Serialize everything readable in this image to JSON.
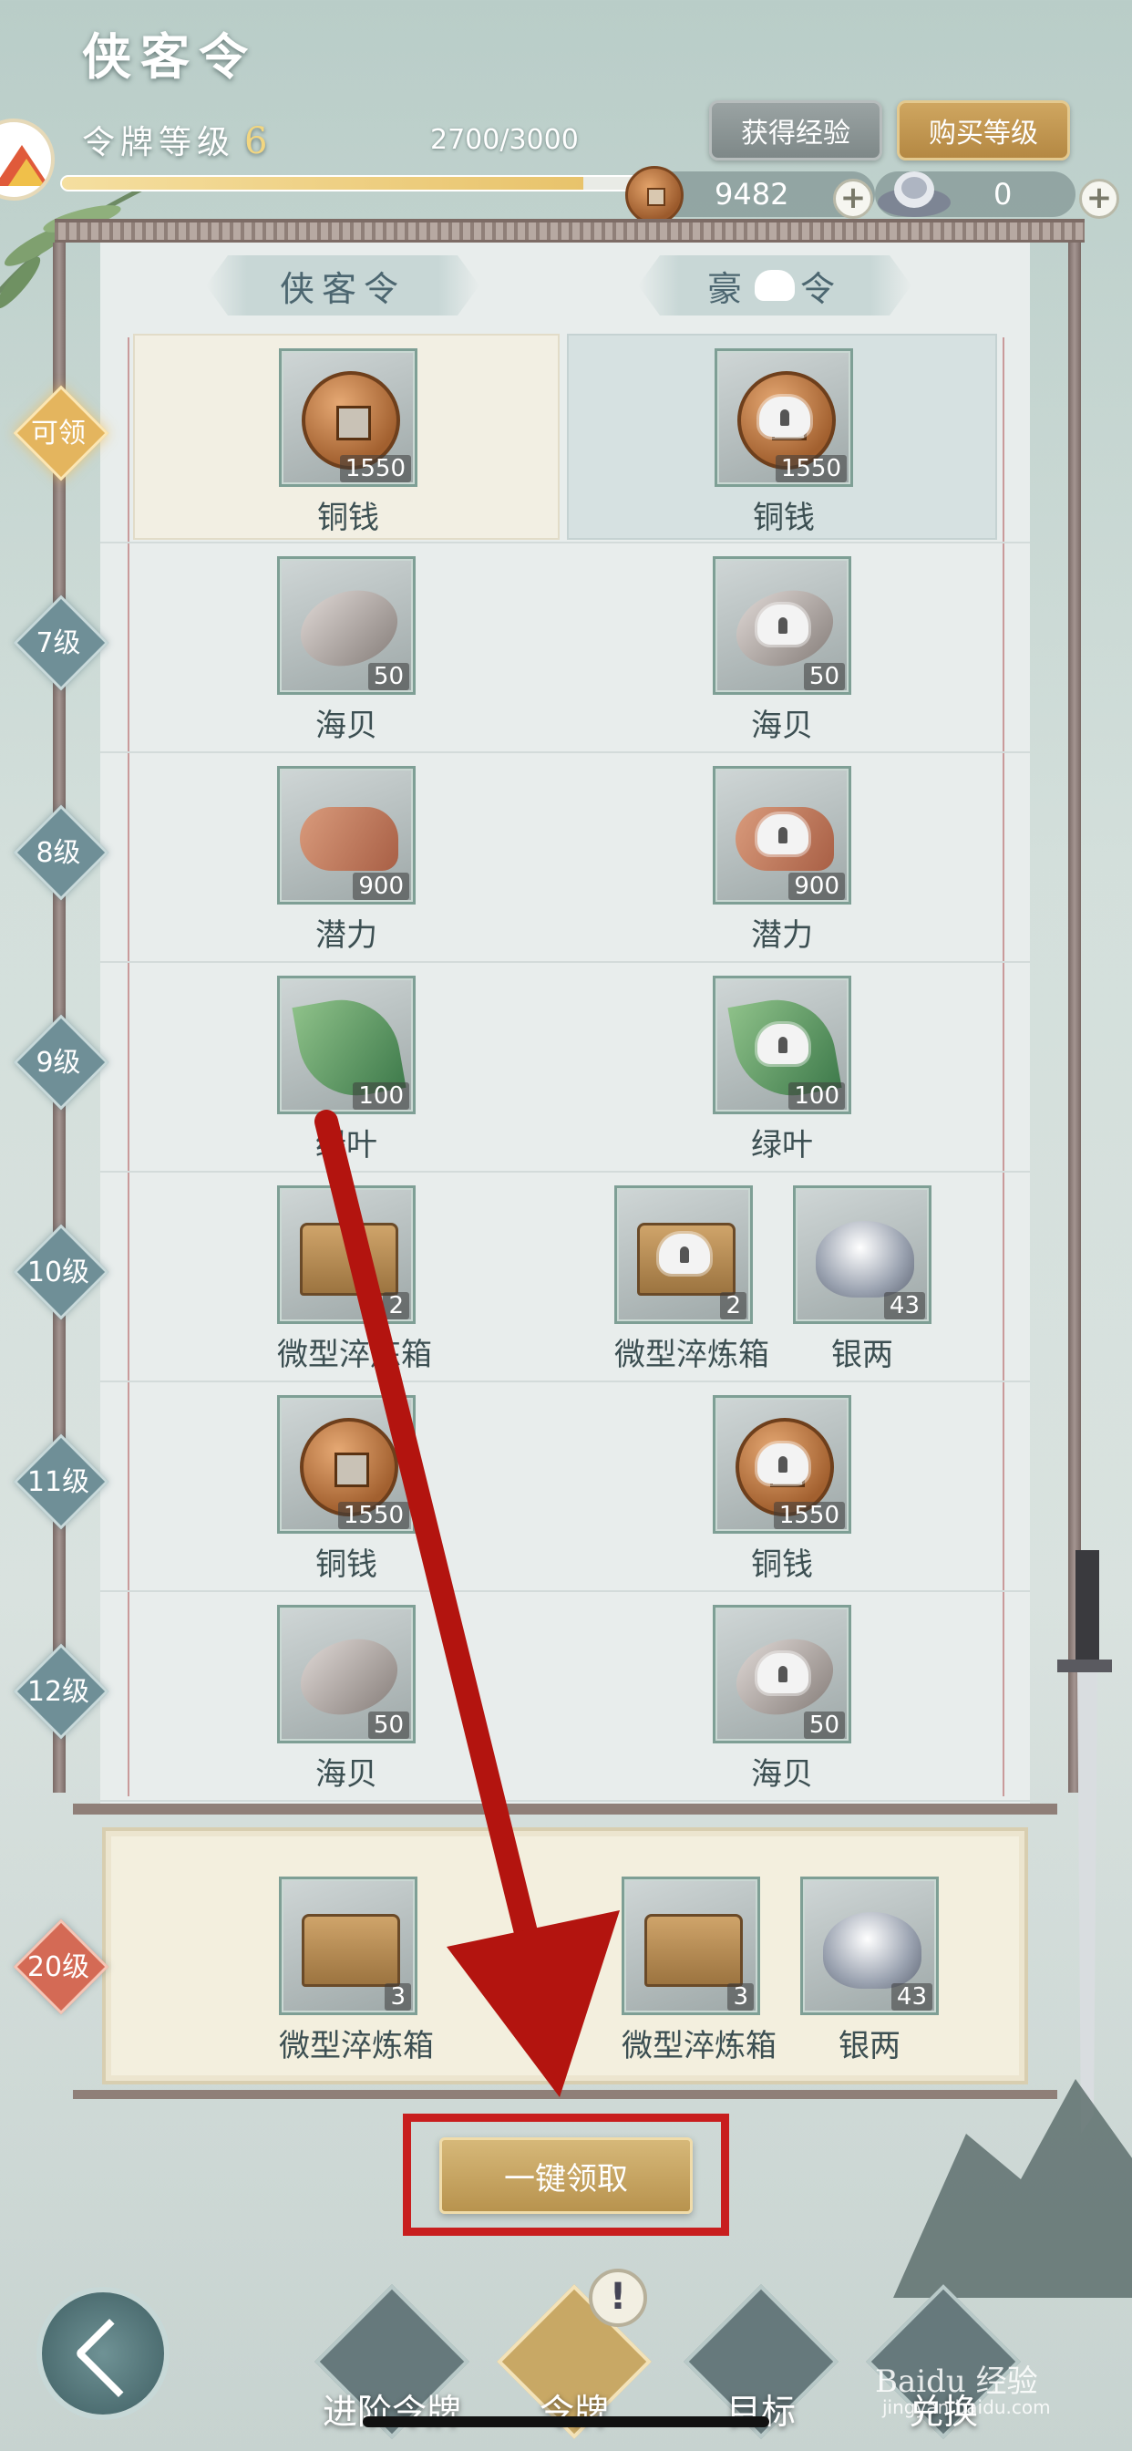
{
  "header": {
    "title": "侠客令",
    "level_label": "令牌等级",
    "level": "6",
    "exp_text": "2700/3000",
    "exp_progress": 0.9,
    "btn_get_exp": "获得经验",
    "btn_buy_level": "购买等级",
    "coin_amount": "9482",
    "silver_amount": "0",
    "plus": "+"
  },
  "columns": {
    "free": "侠客令",
    "hero_left": "豪",
    "hero_right": "令"
  },
  "rows": [
    {
      "badge": "可领",
      "badge_style": "gold",
      "free": [
        {
          "name": "铜钱",
          "count": "1550",
          "art": "coin"
        }
      ],
      "hero": [
        {
          "name": "铜钱",
          "count": "1550",
          "art": "coin"
        }
      ]
    },
    {
      "badge": "7级",
      "free": [
        {
          "name": "海贝",
          "count": "50",
          "art": "shell"
        }
      ],
      "hero": [
        {
          "name": "海贝",
          "count": "50",
          "art": "shell"
        }
      ]
    },
    {
      "badge": "8级",
      "free": [
        {
          "name": "潜力",
          "count": "900",
          "art": "arm"
        }
      ],
      "hero": [
        {
          "name": "潜力",
          "count": "900",
          "art": "arm"
        }
      ]
    },
    {
      "badge": "9级",
      "free": [
        {
          "name": "绿叶",
          "count": "100",
          "art": "leaf"
        }
      ],
      "hero": [
        {
          "name": "绿叶",
          "count": "100",
          "art": "leaf"
        }
      ]
    },
    {
      "badge": "10级",
      "free": [
        {
          "name": "微型淬炼箱",
          "count": "2",
          "art": "chest"
        }
      ],
      "hero": [
        {
          "name": "微型淬炼箱",
          "count": "2",
          "art": "chest"
        },
        {
          "name": "银两",
          "count": "43",
          "art": "silver"
        }
      ]
    },
    {
      "badge": "11级",
      "free": [
        {
          "name": "铜钱",
          "count": "1550",
          "art": "coin"
        }
      ],
      "hero": [
        {
          "name": "铜钱",
          "count": "1550",
          "art": "coin"
        }
      ]
    },
    {
      "badge": "12级",
      "free": [
        {
          "name": "海贝",
          "count": "50",
          "art": "shell"
        }
      ],
      "hero": [
        {
          "name": "海贝",
          "count": "50",
          "art": "shell"
        }
      ]
    }
  ],
  "reward_final": {
    "badge": "20级",
    "free": [
      {
        "name": "微型淬炼箱",
        "count": "3"
      }
    ],
    "hero": [
      {
        "name": "微型淬炼箱",
        "count": "3"
      },
      {
        "name": "银两",
        "count": "43"
      }
    ]
  },
  "claim_button": "一键领取",
  "nav": [
    {
      "label": "进阶令牌"
    },
    {
      "label": "令牌"
    },
    {
      "label": "目标"
    },
    {
      "label": "兑换"
    }
  ],
  "alert": "!",
  "watermark": "Baidu 经验",
  "watermark_url": "jingyan.baidu.com",
  "colors": {
    "accent_gold": "#c8a865",
    "highlight_red": "#c81e1e",
    "arrow_red": "#b3140f"
  }
}
